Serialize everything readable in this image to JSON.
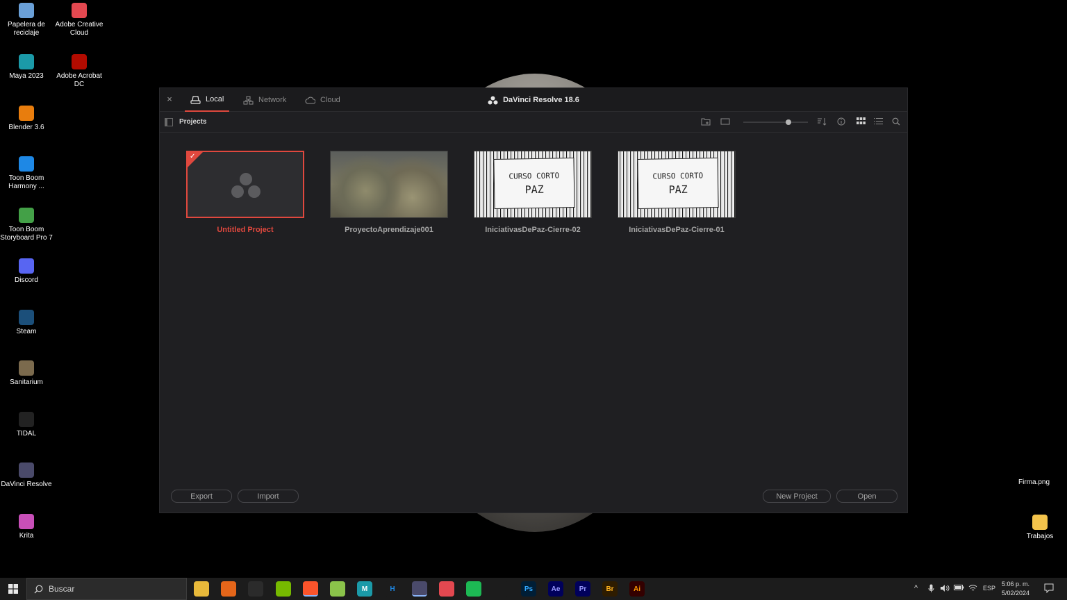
{
  "desktop": {
    "icons_left": [
      {
        "label": "Papelera de reciclaje",
        "icon": "recycle-bin-icon",
        "color": "#6aa0d8"
      },
      {
        "label": "Adobe Creative Cloud",
        "icon": "creative-cloud-icon",
        "color": "#e34850"
      },
      {
        "label": "Maya 2023",
        "icon": "maya-icon",
        "color": "#1b9aa8"
      },
      {
        "label": "Adobe Acrobat DC",
        "icon": "acrobat-icon",
        "color": "#b30b00"
      },
      {
        "label": "Blender 3.6",
        "icon": "blender-icon",
        "color": "#e87d0d"
      },
      {
        "label": "Toon Boom Harmony ...",
        "icon": "harmony-icon",
        "color": "#1e88e5"
      },
      {
        "label": "Toon Boom Storyboard Pro 7",
        "icon": "storyboard-icon",
        "color": "#43a047"
      },
      {
        "label": "Discord",
        "icon": "discord-icon",
        "color": "#5865f2"
      },
      {
        "label": "Steam",
        "icon": "steam-icon",
        "color": "#1b4f7a"
      },
      {
        "label": "Sanitarium",
        "icon": "sanitarium-icon",
        "color": "#7b6a4d"
      },
      {
        "label": "TIDAL",
        "icon": "tidal-icon",
        "color": "#222222"
      },
      {
        "label": "DaVinci Resolve",
        "icon": "davinci-icon",
        "color": "#4a4a6a"
      },
      {
        "label": "Krita",
        "icon": "krita-icon",
        "color": "#c84fb8"
      }
    ],
    "firma": "Firma.png",
    "trabajos": "Trabajos"
  },
  "window": {
    "close_glyph": "×",
    "tabs": [
      {
        "label": "Local",
        "active": true
      },
      {
        "label": "Network",
        "active": false
      },
      {
        "label": "Cloud",
        "active": false
      }
    ],
    "app_title": "DaVinci Resolve 18.6",
    "toolbar": {
      "projects_label": "Projects",
      "zoom_level": 0.7
    },
    "projects": [
      {
        "name": "Untitled Project",
        "selected": true,
        "thumb": "davinci-logo"
      },
      {
        "name": "ProyectoAprendizaje001",
        "selected": false,
        "thumb": "plants"
      },
      {
        "name": "IniciativasDePaz-Cierre-02",
        "selected": false,
        "thumb": "sketch",
        "sketch_line1": "CURSO CORTO",
        "sketch_line2": "PAZ"
      },
      {
        "name": "IniciativasDePaz-Cierre-01",
        "selected": false,
        "thumb": "sketch",
        "sketch_line1": "CURSO CORTO",
        "sketch_line2": "PAZ"
      }
    ],
    "buttons": {
      "export": "Export",
      "import": "Import",
      "new_project": "New Project",
      "open": "Open"
    }
  },
  "taskbar": {
    "search_placeholder": "Buscar",
    "apps": [
      {
        "name": "file-explorer-icon",
        "glyph": "",
        "bg": "#e8b93a",
        "fg": "#000"
      },
      {
        "name": "firefox-icon",
        "glyph": "",
        "bg": "#e5661a",
        "fg": "#fff"
      },
      {
        "name": "obs-icon",
        "glyph": "",
        "bg": "#2b2b2b",
        "fg": "#fff"
      },
      {
        "name": "nvidia-icon",
        "glyph": "",
        "bg": "#76b900",
        "fg": "#000"
      },
      {
        "name": "brave-icon",
        "glyph": "",
        "bg": "#fb542b",
        "fg": "#fff"
      },
      {
        "name": "greenshot-icon",
        "glyph": "",
        "bg": "#8bc34a",
        "fg": "#000"
      },
      {
        "name": "maya-icon",
        "glyph": "M",
        "bg": "#1b9aa8",
        "fg": "#fff"
      },
      {
        "name": "harmony-icon",
        "glyph": "H",
        "bg": "#1c1c1c",
        "fg": "#1e88e5"
      },
      {
        "name": "davinci-icon",
        "glyph": "",
        "bg": "#4a4a6a",
        "fg": "#fff"
      },
      {
        "name": "creative-cloud-icon",
        "glyph": "",
        "bg": "#e34850",
        "fg": "#fff"
      },
      {
        "name": "spotify-icon",
        "glyph": "",
        "bg": "#1db954",
        "fg": "#000"
      },
      {
        "name": "tidal-icon",
        "glyph": "",
        "bg": "#1c1c1c",
        "fg": "#fff"
      },
      {
        "name": "photoshop-icon",
        "glyph": "Ps",
        "bg": "#001e36",
        "fg": "#31a8ff"
      },
      {
        "name": "after-effects-icon",
        "glyph": "Ae",
        "bg": "#00005b",
        "fg": "#9999ff"
      },
      {
        "name": "premiere-icon",
        "glyph": "Pr",
        "bg": "#00005b",
        "fg": "#9999ff"
      },
      {
        "name": "bridge-icon",
        "glyph": "Br",
        "bg": "#2e1c00",
        "fg": "#ffb21f"
      },
      {
        "name": "illustrator-icon",
        "glyph": "Ai",
        "bg": "#330000",
        "fg": "#ff9a00"
      }
    ],
    "language": "ESP",
    "time": "5:06 p. m.",
    "date": "5/02/2024"
  }
}
